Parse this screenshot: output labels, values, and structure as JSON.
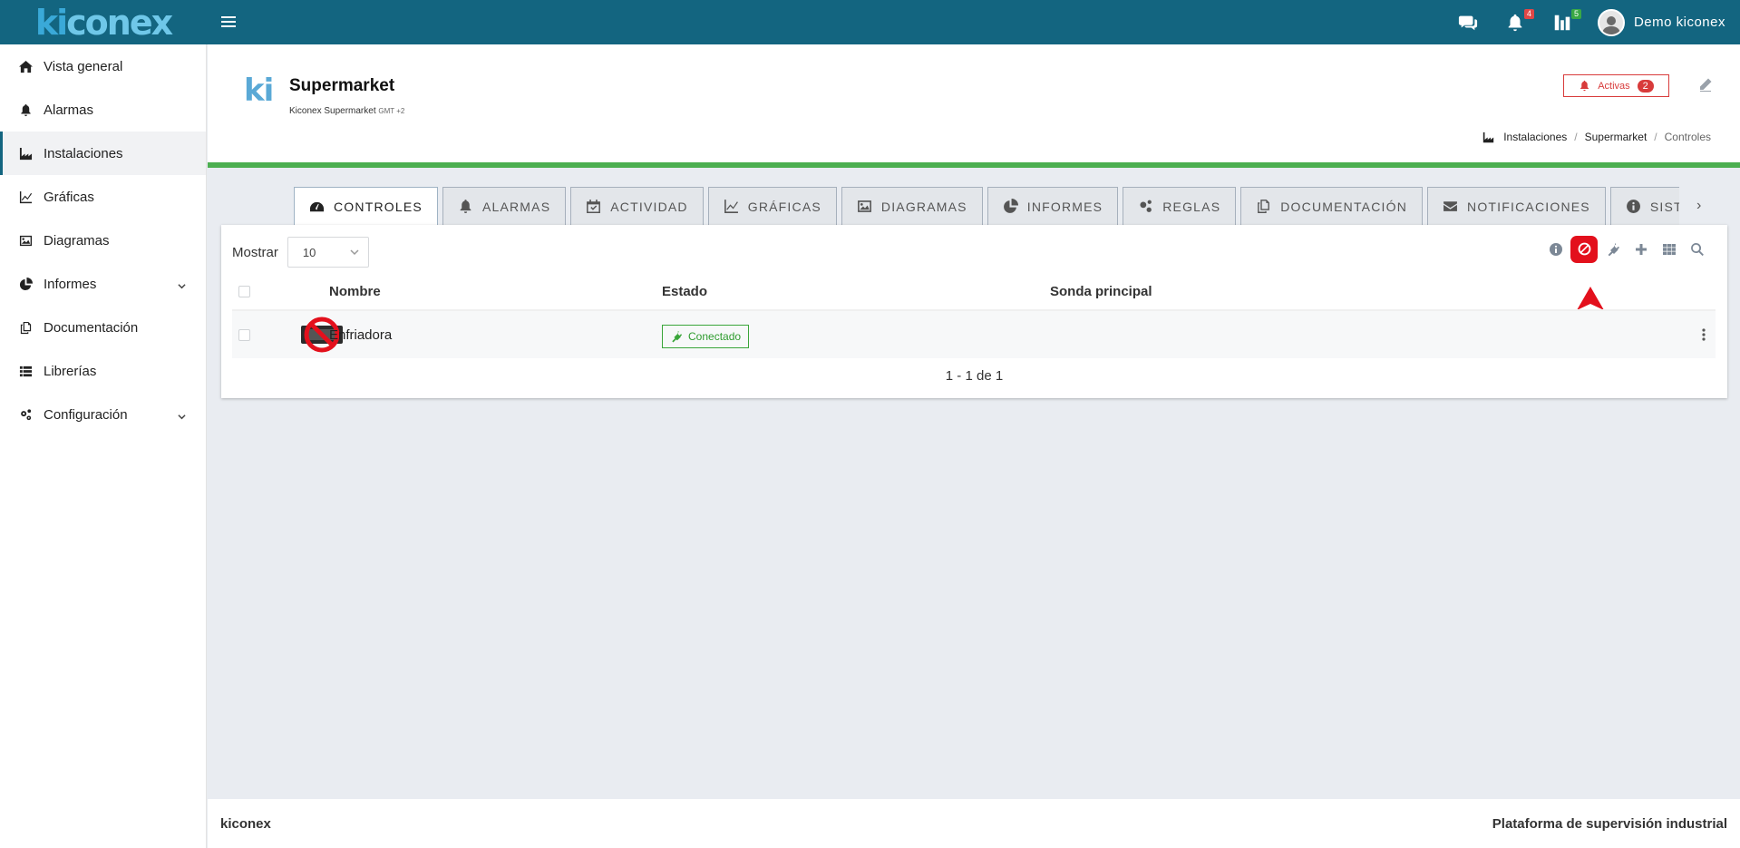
{
  "app": {
    "logo_prefix": "ki",
    "logo_suffix": "conex",
    "notifications_count": "4",
    "tasks_count": "5",
    "user_name": "Demo kiconex"
  },
  "sidebar": {
    "items": [
      {
        "label": "Vista general",
        "icon": "home-icon"
      },
      {
        "label": "Alarmas",
        "icon": "bell-icon"
      },
      {
        "label": "Instalaciones",
        "icon": "industry-icon",
        "active": true
      },
      {
        "label": "Gráficas",
        "icon": "line-chart-icon"
      },
      {
        "label": "Diagramas",
        "icon": "image-icon"
      },
      {
        "label": "Informes",
        "icon": "pie-chart-icon",
        "expandable": true
      },
      {
        "label": "Documentación",
        "icon": "copy-icon"
      },
      {
        "label": "Librerías",
        "icon": "list-icon"
      },
      {
        "label": "Configuración",
        "icon": "cogs-icon",
        "expandable": true
      }
    ]
  },
  "header": {
    "logo_text": "ki",
    "title": "Supermarket",
    "subtitle": "Kiconex Supermarket",
    "timezone": "GMT +2",
    "activas_label": "Activas",
    "activas_count": "2",
    "breadcrumb": [
      "Instalaciones",
      "Supermarket",
      "Controles"
    ]
  },
  "tabs": [
    {
      "label": "CONTROLES",
      "icon": "dashboard-icon",
      "active": true
    },
    {
      "label": "ALARMAS",
      "icon": "bell-icon"
    },
    {
      "label": "ACTIVIDAD",
      "icon": "calendar-icon"
    },
    {
      "label": "GRÁFICAS",
      "icon": "line-chart-icon"
    },
    {
      "label": "DIAGRAMAS",
      "icon": "image-icon"
    },
    {
      "label": "INFORMES",
      "icon": "pie-chart-icon"
    },
    {
      "label": "REGLAS",
      "icon": "cogs-icon"
    },
    {
      "label": "DOCUMENTACIÓN",
      "icon": "copy-icon"
    },
    {
      "label": "NOTIFICACIONES",
      "icon": "envelope-icon"
    },
    {
      "label": "SISTEMA",
      "icon": "info-icon"
    }
  ],
  "tab_next": "›",
  "table": {
    "show_label": "Mostrar",
    "page_size": "10",
    "columns": [
      "Nombre",
      "Estado",
      "Sonda principal"
    ],
    "rows": [
      {
        "nombre": "Enfriadora",
        "estado": "Conectado",
        "sonda": ""
      }
    ],
    "pagination": "1 - 1 de 1"
  },
  "colors": {
    "topbar": "#136580",
    "accent_green": "#4caf50",
    "alert_red": "#d83b3b",
    "highlight_red": "#e3101c"
  },
  "footer": {
    "left": "kiconex",
    "right": "Plataforma de supervisión industrial"
  }
}
